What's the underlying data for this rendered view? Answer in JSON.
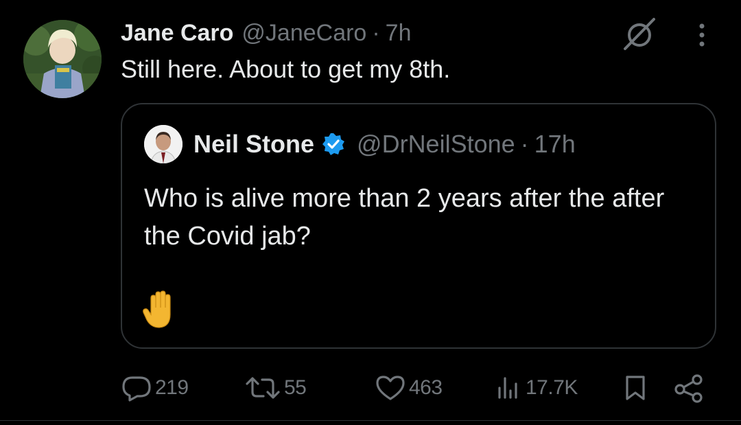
{
  "tweet": {
    "author_name": "Jane Caro",
    "author_handle": "@JaneCaro",
    "separator": "·",
    "time": "7h",
    "text": "Still here. About to get my 8th."
  },
  "quote": {
    "author_name": "Neil Stone",
    "author_handle": "@DrNeilStone",
    "separator": "·",
    "time": "17h",
    "text": "Who is alive more than 2 years after the after the Covid jab?",
    "emoji": "✋"
  },
  "actions": {
    "replies": "219",
    "reposts": "55",
    "likes": "463",
    "views": "17.7K"
  },
  "icons": {
    "header": [
      "grok-icon",
      "more-icon"
    ],
    "actions": [
      "reply-icon",
      "repost-icon",
      "like-icon",
      "views-icon",
      "bookmark-icon",
      "share-icon"
    ]
  },
  "colors": {
    "background": "#000000",
    "primary_text": "#e7e9ea",
    "secondary_text": "#71767b",
    "border": "#2f3336",
    "verified": "#1d9bf0"
  }
}
